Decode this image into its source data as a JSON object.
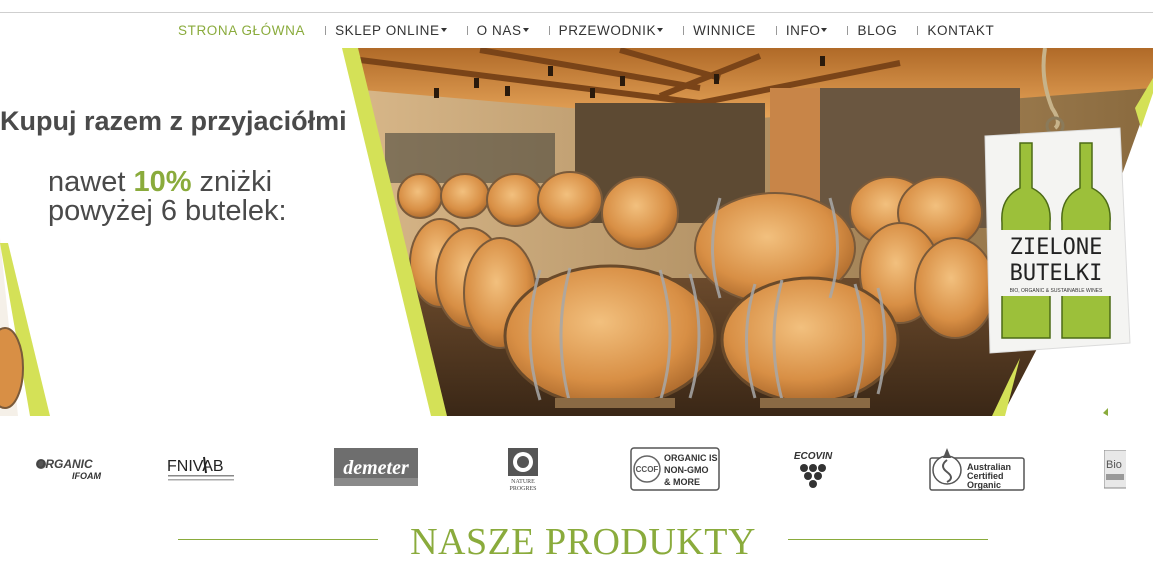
{
  "nav": {
    "items": [
      {
        "label": "STRONA GŁÓWNA",
        "active": true,
        "dropdown": false
      },
      {
        "label": "SKLEP ONLINE",
        "active": false,
        "dropdown": true
      },
      {
        "label": "O NAS",
        "active": false,
        "dropdown": true
      },
      {
        "label": "PRZEWODNIK",
        "active": false,
        "dropdown": true
      },
      {
        "label": "WINNICE",
        "active": false,
        "dropdown": false
      },
      {
        "label": "INFO",
        "active": false,
        "dropdown": true
      },
      {
        "label": "BLOG",
        "active": false,
        "dropdown": false
      },
      {
        "label": "KONTAKT",
        "active": false,
        "dropdown": false
      }
    ]
  },
  "hero": {
    "headline": "Kupuj razem z przyjaciółmi",
    "promo_prefix": "nawet ",
    "promo_percent": "10%",
    "promo_suffix": " zniżki",
    "promo_line2": "powyżej 6 butelek:",
    "tag": {
      "brand_line1": "ZIELONE",
      "brand_line2": "BUTELKI",
      "tagline": "BIO, ORGANIC & SUSTAINABLE WINES"
    }
  },
  "certifications": {
    "organic_ifoam_1": "ORGANIC",
    "organic_ifoam_2": "IFOAM",
    "fnivab": "FNIVAB",
    "demeter": "demeter",
    "nature_progres_1": "NATURE",
    "nature_progres_2": "PROGRES",
    "ccof_1": "ORGANIC IS",
    "ccof_2": "NON-GMO",
    "ccof_3": "& MORE",
    "ccof_badge": "CCOF",
    "ecovin": "ECOVIN",
    "aco_1": "Australian",
    "aco_2": "Certified",
    "aco_3": "Organic",
    "bio": "Bio"
  },
  "section": {
    "title": "NASZE PRODUKTY"
  },
  "colors": {
    "accent": "#8aab3c",
    "lime": "#d4e157",
    "text": "#4a4a4a"
  }
}
